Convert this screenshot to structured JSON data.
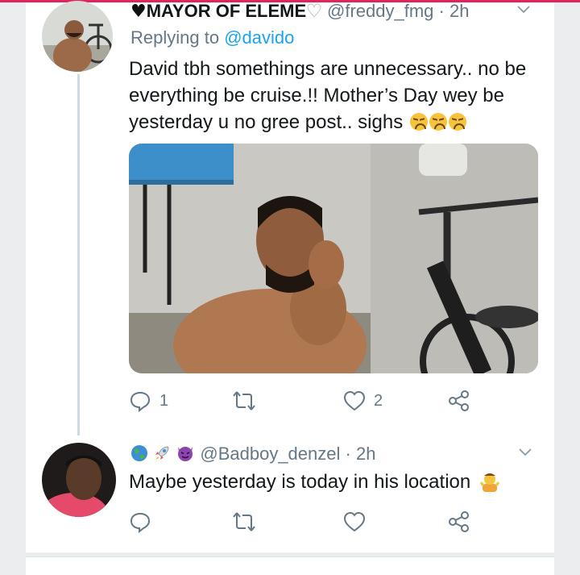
{
  "colors": {
    "accent": "#1da1f2",
    "meta_text": "#657786",
    "top_bar": "#e0245e",
    "thread_line": "#cfd9de"
  },
  "tweets": [
    {
      "display_name": "MAYOR OF ELEME",
      "name_prefix_emoji": "black-heart",
      "name_suffix_emoji": "white-heart",
      "handle": "@freddy_fmg",
      "time": "· 2h",
      "replying_to_label": "Replying to",
      "replying_to_handle": "@davido",
      "text": "David tbh somethings are unnecessary.. no be everything be cruise.!! Mother’s Day wey be yesterday u no gree post.. sighs",
      "trailing_emojis": [
        "disappointed-face",
        "disappointed-face",
        "disappointed-face"
      ],
      "media": "photo of a man resting his head on his hand next to a bicycle",
      "actions": {
        "reply_count": "1",
        "retweet_count": "",
        "like_count": "2"
      }
    },
    {
      "name_emojis": [
        "globe-icon",
        "rocket-icon",
        "devil-icon"
      ],
      "handle": "@Badboy_denzel",
      "time": "· 2h",
      "text": "Maybe yesterday is today in his location",
      "trailing_emoji": "person-shrugging",
      "actions": {
        "reply_count": "",
        "retweet_count": "",
        "like_count": ""
      }
    }
  ]
}
